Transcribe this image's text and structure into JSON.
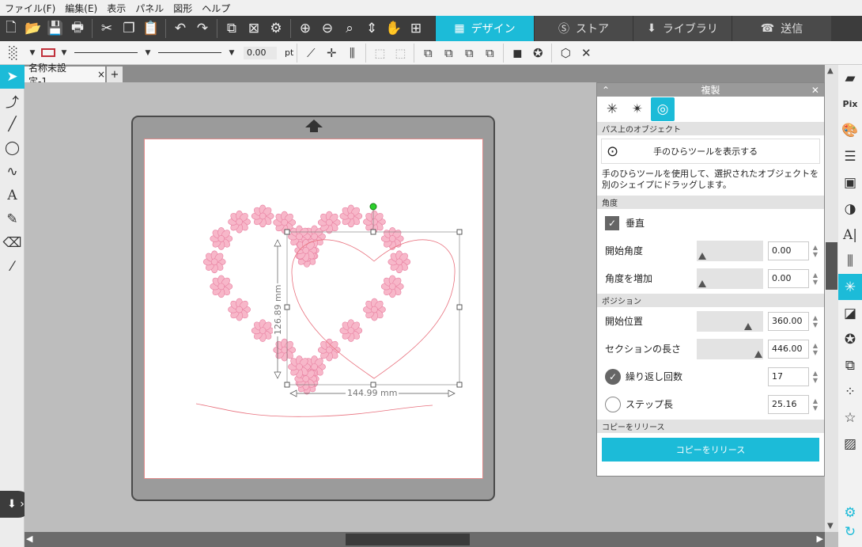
{
  "menu": [
    "ファイル(F)",
    "編集(E)",
    "表示",
    "パネル",
    "図形",
    "ヘルプ"
  ],
  "tabs": [
    {
      "label": "デザイン",
      "icon": "grid-icon",
      "active": true
    },
    {
      "label": "ストア",
      "icon": "store-icon",
      "active": false
    },
    {
      "label": "ライブラリ",
      "icon": "library-icon",
      "active": false
    },
    {
      "label": "送信",
      "icon": "send-icon",
      "active": false
    }
  ],
  "toolbar2": {
    "line_width_value": "0.00",
    "line_width_unit": "pt"
  },
  "document": {
    "tab_title": "名称未設定-1",
    "close_glyph": "×",
    "add_glyph": "+"
  },
  "canvas": {
    "height_dim": "126.89 mm",
    "width_dim": "144.99 mm"
  },
  "panel": {
    "title": "複製",
    "section_path": "パス上のオブジェクト",
    "show_hand_button": "手のひらツールを表示する",
    "description": "手のひらツールを使用して、選択されたオブジェクトを別のシェイプにドラッグします。",
    "section_angle": "角度",
    "vertical_label": "垂直",
    "vertical_checked": true,
    "start_angle_label": "開始角度",
    "start_angle_value": "0.00",
    "start_angle_level": 0,
    "angle_increment_label": "角度を増加",
    "angle_increment_value": "0.00",
    "angle_increment_level": 0,
    "section_position": "ポジション",
    "start_position_label": "開始位置",
    "start_position_value": "360.00",
    "start_position_level": 0.8,
    "section_length_label": "セクションの長さ",
    "section_length_value": "446.00",
    "section_length_level": 0.98,
    "repeat_count_label": "繰り返し回数",
    "repeat_count_value": "17",
    "step_length_label": "ステップ長",
    "step_length_value": "25.16",
    "section_release": "コピーをリリース",
    "release_button": "コピーをリリース"
  },
  "colors": {
    "accent": "#1cbbd8",
    "flower": "#f7b7c9",
    "flower_stroke": "#e87fa0",
    "cut_line": "#e8707d"
  }
}
